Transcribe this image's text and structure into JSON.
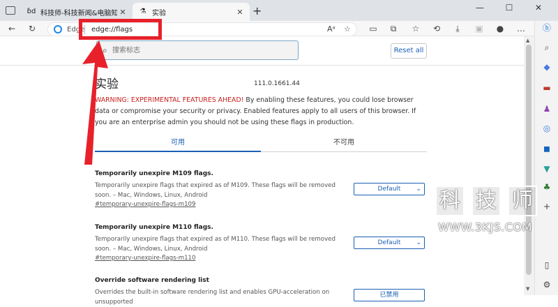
{
  "tabs": [
    {
      "title": "科技师-科技新闻&电脑知识",
      "icon": "3kjs-logo-icon"
    },
    {
      "title": "实验",
      "icon": "flask-icon"
    }
  ],
  "window": {
    "new_tab": "+",
    "minimize": "—",
    "maximize": "☐",
    "close": "✕"
  },
  "address_bar": {
    "site_label": "Edge",
    "url": "edge://flags"
  },
  "search": {
    "placeholder": "搜索标志"
  },
  "reset_button": "Reset all",
  "page": {
    "title": "实验",
    "version": "111.0.1661.44",
    "warning_prefix": "WARNING: EXPERIMENTAL FEATURES AHEAD!",
    "warning_text": " By enabling these features, you could lose browser data or compromise your security or privacy. Enabled features apply to all users of this browser. If you are an enterprise admin you should not be using these flags in production."
  },
  "content_tabs": {
    "available": "可用",
    "unavailable": "不可用"
  },
  "flags": [
    {
      "name": "Temporarily unexpire M109 flags.",
      "description": "Temporarily unexpire flags that expired as of M109. These flags will be removed soon. – Mac, Windows, Linux, Android",
      "link": "#temporary-unexpire-flags-m109",
      "value": "Default"
    },
    {
      "name": "Temporarily unexpire M110 flags.",
      "description": "Temporarily unexpire flags that expired as of M110. These flags will be removed soon. – Mac, Windows, Linux, Android",
      "link": "#temporary-unexpire-flags-m110",
      "value": "Default"
    },
    {
      "name": "Override software rendering list",
      "description": "Overrides the built-in software rendering list and enables GPU-acceleration on unsupported",
      "link": "",
      "value": "已禁用"
    }
  ],
  "watermark": {
    "chars": [
      "科",
      "技",
      "师"
    ],
    "url": "WWW.3KJS.COM"
  },
  "colors": {
    "accent": "#1a5fb4",
    "annotation_red": "#e8202a",
    "warning_red": "#c5221f"
  }
}
